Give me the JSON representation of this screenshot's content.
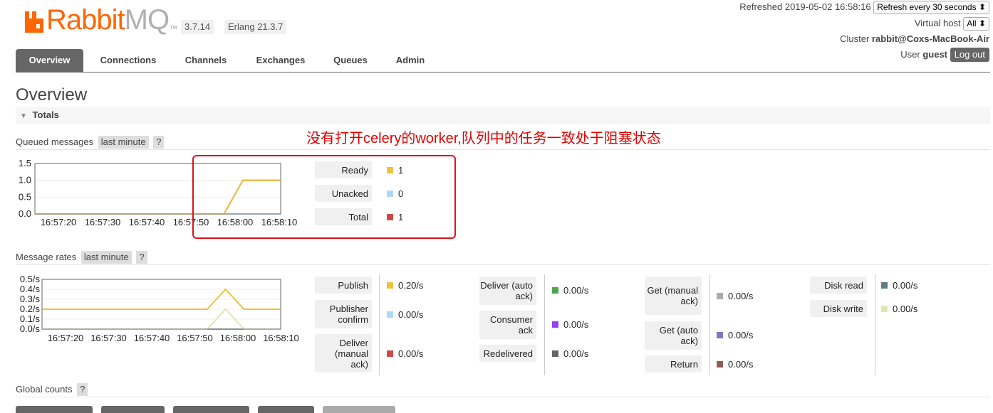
{
  "header": {
    "logo_main": "Rabbit",
    "logo_mq": "MQ",
    "logo_tm": "TM",
    "version": "3.7.14",
    "erlang": "Erlang 21.3.7",
    "refreshed": "Refreshed 2019-05-02 16:58:16",
    "refresh_select": "Refresh every 30 seconds",
    "vhost_label": "Virtual host",
    "vhost_value": "All",
    "cluster_label": "Cluster",
    "cluster_value": "rabbit@Coxs-MacBook-Air",
    "user_label": "User",
    "user_value": "guest",
    "logout": "Log out",
    "colors": {
      "brand": "#ff6600",
      "nav_active": "#666666"
    }
  },
  "nav": {
    "tabs": [
      {
        "label": "Overview",
        "active": true
      },
      {
        "label": "Connections",
        "active": false
      },
      {
        "label": "Channels",
        "active": false
      },
      {
        "label": "Exchanges",
        "active": false
      },
      {
        "label": "Queues",
        "active": false
      },
      {
        "label": "Admin",
        "active": false
      }
    ]
  },
  "page": {
    "title": "Overview",
    "totals_label": "Totals",
    "annotation": "没有打开celery的worker,队列中的任务一致处于阻塞状态"
  },
  "queued": {
    "label": "Queued messages",
    "range": "last minute",
    "help": "?",
    "legend": [
      {
        "label": "Ready",
        "value": "1",
        "color": "#edc240"
      },
      {
        "label": "Unacked",
        "value": "0",
        "color": "#afd8f8"
      },
      {
        "label": "Total",
        "value": "1",
        "color": "#cb4b4b"
      }
    ]
  },
  "rates": {
    "label": "Message rates",
    "range": "last minute",
    "help": "?",
    "col1": [
      {
        "label": "Publish",
        "value": "0.20/s",
        "color": "#edc240"
      },
      {
        "label": "Publisher confirm",
        "value": "0.00/s",
        "color": "#afd8f8"
      },
      {
        "label": "Deliver (manual ack)",
        "value": "0.00/s",
        "color": "#cb4b4b"
      }
    ],
    "col2": [
      {
        "label": "Deliver (auto ack)",
        "value": "0.00/s",
        "color": "#4da74d"
      },
      {
        "label": "Consumer ack",
        "value": "0.00/s",
        "color": "#9440ed"
      },
      {
        "label": "Redelivered",
        "value": "0.00/s",
        "color": "#666666"
      }
    ],
    "col3": [
      {
        "label": "Get (manual ack)",
        "value": "0.00/s",
        "color": "#aaaaaa"
      },
      {
        "label": "Get (auto ack)",
        "value": "0.00/s",
        "color": "#7c79c3"
      },
      {
        "label": "Return",
        "value": "0.00/s",
        "color": "#8f5c5c"
      }
    ],
    "col4": [
      {
        "label": "Disk read",
        "value": "0.00/s",
        "color": "#637b85"
      },
      {
        "label": "Disk write",
        "value": "0.00/s",
        "color": "#dce8b4"
      }
    ]
  },
  "global_counts": {
    "label": "Global counts",
    "help": "?"
  },
  "chart_data": [
    {
      "type": "line",
      "title": "Queued messages",
      "x": [
        "16:57:20",
        "16:57:30",
        "16:57:40",
        "16:57:50",
        "16:58:00",
        "16:58:10"
      ],
      "x_points": [
        0,
        5,
        10,
        15,
        20,
        25,
        30,
        35,
        40,
        45,
        50,
        55,
        60,
        65
      ],
      "ylim": [
        0,
        1.5
      ],
      "yticks": [
        "1.5",
        "1.0",
        "0.5",
        "0.0"
      ],
      "grid": true,
      "series": [
        {
          "name": "Ready",
          "color": "#edc240",
          "values": [
            0,
            0,
            0,
            0,
            0,
            0,
            0,
            0,
            0,
            0,
            0,
            1,
            1,
            1
          ]
        },
        {
          "name": "Unacked",
          "color": "#afd8f8",
          "values": [
            0,
            0,
            0,
            0,
            0,
            0,
            0,
            0,
            0,
            0,
            0,
            0,
            0,
            0
          ]
        },
        {
          "name": "Total",
          "color": "#cb4b4b",
          "values": [
            0,
            0,
            0,
            0,
            0,
            0,
            0,
            0,
            0,
            0,
            0,
            1,
            1,
            1
          ]
        }
      ]
    },
    {
      "type": "line",
      "title": "Message rates",
      "x": [
        "16:57:20",
        "16:57:30",
        "16:57:40",
        "16:57:50",
        "16:58:00",
        "16:58:10"
      ],
      "x_points": [
        0,
        5,
        10,
        15,
        20,
        25,
        30,
        35,
        40,
        45,
        50,
        55,
        60,
        65
      ],
      "ylim": [
        0,
        0.5
      ],
      "yticks": [
        "0.5/s",
        "0.4/s",
        "0.3/s",
        "0.2/s",
        "0.1/s",
        "0.0/s"
      ],
      "grid": true,
      "series": [
        {
          "name": "Publish",
          "color": "#edc240",
          "values": [
            0.2,
            0.2,
            0.2,
            0.2,
            0.2,
            0.2,
            0.2,
            0.2,
            0.2,
            0.2,
            0.4,
            0.2,
            0.2,
            0.2
          ]
        },
        {
          "name": "Disk write",
          "color": "#dce8b4",
          "values": [
            0,
            0,
            0,
            0,
            0,
            0,
            0,
            0,
            0,
            0,
            0.2,
            0,
            0,
            0
          ]
        },
        {
          "name": "Disk read",
          "color": "#637b85",
          "values": [
            0,
            0,
            0,
            0,
            0,
            0,
            0,
            0,
            0,
            0,
            0,
            0,
            0,
            0
          ]
        }
      ]
    }
  ]
}
